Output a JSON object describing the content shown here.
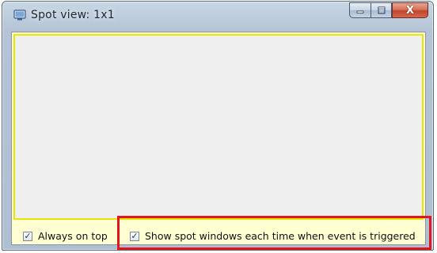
{
  "window": {
    "title": "Spot view: 1x1",
    "app_icon": "window-app-icon",
    "caption_buttons": {
      "minimize_icon": "minimize-icon",
      "maximize_icon": "maximize-icon",
      "close_label": "X"
    }
  },
  "view": {
    "background": "#efefef",
    "border_color": "#e8e600"
  },
  "options": {
    "always_on_top": {
      "label": "Always on top",
      "checked": true
    },
    "show_spot_windows": {
      "label": "Show spot windows each time when event is triggered",
      "checked": true
    }
  },
  "highlight": {
    "color": "#e3161d"
  },
  "colors": {
    "panel_background": "#ffffd2",
    "close_button": "#c2452b"
  }
}
